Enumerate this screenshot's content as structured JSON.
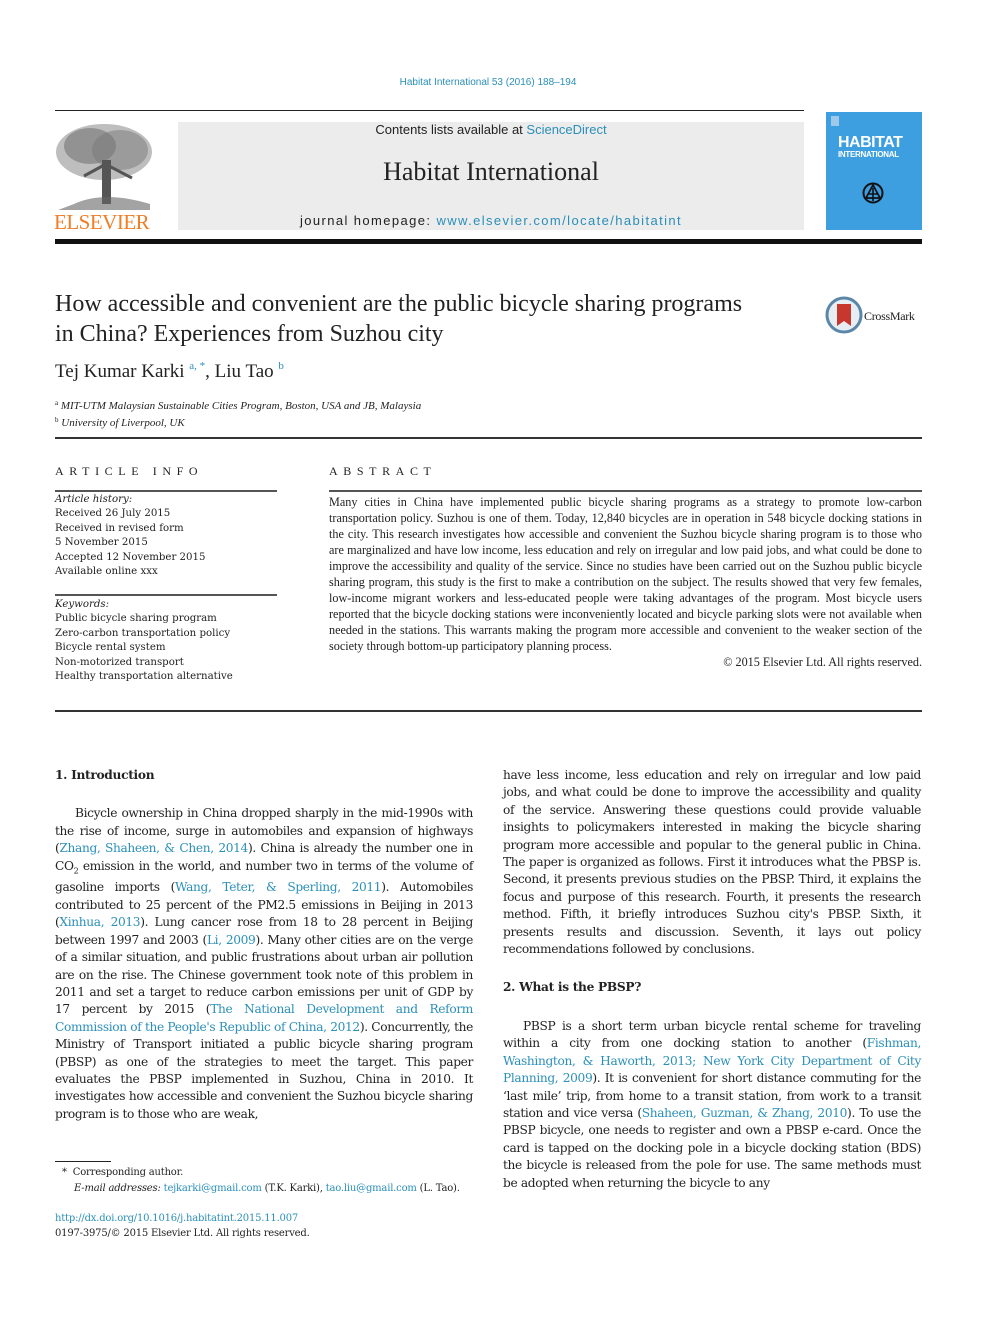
{
  "citation": "Habitat International 53 (2016) 188–194",
  "masthead": {
    "contents_prefix": "Contents lists available at ",
    "contents_link": "ScienceDirect",
    "journal_name": "Habitat International",
    "homepage_prefix": "journal homepage: ",
    "homepage_link": "www.elsevier.com/locate/habitatint"
  },
  "publisher_logo": "ELSEVIER",
  "cover": {
    "title": "HABITAT",
    "subtitle": "INTERNATIONAL"
  },
  "crossmark_label": "CrossMark",
  "article": {
    "title": "How accessible and convenient are the public bicycle sharing programs in China? Experiences from Suzhou city",
    "authors": [
      {
        "name": "Tej Kumar Karki",
        "marks": "a, *"
      },
      {
        "name": "Liu Tao",
        "marks": "b"
      }
    ],
    "affiliations": [
      {
        "mark": "a",
        "text": "MIT-UTM Malaysian Sustainable Cities Program, Boston, USA and JB, Malaysia"
      },
      {
        "mark": "b",
        "text": "University of Liverpool, UK"
      }
    ]
  },
  "article_info": {
    "heading": "ARTICLE INFO",
    "history_label": "Article history:",
    "history": [
      "Received 26 July 2015",
      "Received in revised form",
      "5 November 2015",
      "Accepted 12 November 2015",
      "Available online xxx"
    ],
    "keywords_label": "Keywords:",
    "keywords": [
      "Public bicycle sharing program",
      "Zero-carbon transportation policy",
      "Bicycle rental system",
      "Non-motorized transport",
      "Healthy transportation alternative"
    ]
  },
  "abstract": {
    "heading": "ABSTRACT",
    "text": "Many cities in China have implemented public bicycle sharing programs as a strategy to promote low-carbon transportation policy. Suzhou is one of them. Today, 12,840 bicycles are in operation in 548 bicycle docking stations in the city. This research investigates how accessible and convenient the Suzhou bicycle sharing program is to those who are marginalized and have low income, less education and rely on irregular and low paid jobs, and what could be done to improve the accessibility and quality of the service. Since no studies have been carried out on the Suzhou public bicycle sharing program, this study is the first to make a contribution on the subject. The results showed that very few females, low-income migrant workers and less-educated people were taking advantages of the program. Most bicycle users reported that the bicycle docking stations were inconveniently located and bicycle parking slots were not available when needed in the stations. This warrants making the program more accessible and convenient to the weaker section of the society through bottom-up participatory planning process.",
    "copyright": "© 2015 Elsevier Ltd. All rights reserved."
  },
  "body": {
    "section1": {
      "heading": "1.  Introduction",
      "segments": [
        {
          "t": "Bicycle ownership in China dropped sharply in the mid-1990s with the rise of income, surge in automobiles and expansion of highways ("
        },
        {
          "link": "Zhang, Shaheen, & Chen, 2014"
        },
        {
          "t": "). China is already the number one in CO"
        },
        {
          "sub": "2"
        },
        {
          "t": " emission in the world, and number two in terms of the volume of gasoline imports ("
        },
        {
          "link": "Wang, Teter, & Sperling, 2011"
        },
        {
          "t": "). Automobiles contributed to 25 percent of the PM2.5 emissions in Beijing in 2013 ("
        },
        {
          "link": "Xinhua, 2013"
        },
        {
          "t": "). Lung cancer rose from 18 to 28 percent in Beijing between 1997 and 2003 ("
        },
        {
          "link": "Li, 2009"
        },
        {
          "t": "). Many other cities are on the verge of a similar situation, and public frustrations about urban air pollution are on the rise. The Chinese government took note of this problem in 2011 and set a target to reduce carbon emissions per unit of GDP by 17 percent by 2015 ("
        },
        {
          "link": "The National Development and Reform Commission of the People's Republic of China, 2012"
        },
        {
          "t": "). Concurrently, the Ministry of Transport initiated a public bicycle sharing program (PBSP) as one of the strategies to meet the target. This paper evaluates the PBSP implemented in Suzhou, China in 2010. It investigates how accessible and convenient the Suzhou bicycle sharing program is to those who are weak, "
        }
      ],
      "continuation": "have less income, less education and rely on irregular and low paid jobs, and what could be done to improve the accessibility and quality of the service. Answering these questions could provide valuable insights to policymakers interested in making the bicycle sharing program more accessible and popular to the general public in China. The paper is organized as follows. First it introduces what the PBSP is. Second, it presents previous studies on the PBSP. Third, it explains the focus and purpose of this research. Fourth, it presents the research method. Fifth, it briefly introduces Suzhou city's PBSP. Sixth, it presents results and discussion. Seventh, it lays out policy recommendations followed by conclusions."
    },
    "section2": {
      "heading": "2.  What is the PBSP?",
      "segments": [
        {
          "t": "PBSP is a short term urban bicycle rental scheme for traveling within a city from one docking station to another ("
        },
        {
          "link": "Fishman, Washington, & Haworth, 2013; New York City Department of City Planning, 2009"
        },
        {
          "t": "). It is convenient for short distance commuting for the ‘last mile’ trip, from home to a transit station, from work to a transit station and vice versa ("
        },
        {
          "link": "Shaheen, Guzman, & Zhang, 2010"
        },
        {
          "t": "). To use the PBSP bicycle, one needs to register and own a PBSP e-card. Once the card is tapped on the docking pole in a bicycle docking station (BDS) the bicycle is released from the pole for use. The same methods must be adopted when returning the bicycle to any"
        }
      ]
    }
  },
  "footnote": {
    "mark": "*",
    "corresponding": "Corresponding author.",
    "email_label": "E-mail addresses:",
    "emails": [
      {
        "address": "tejkarki@gmail.com",
        "owner": "(T.K. Karki)"
      },
      {
        "address": "tao.liu@gmail.com",
        "owner": "(L. Tao)."
      }
    ]
  },
  "doi": "http://dx.doi.org/10.1016/j.habitatint.2015.11.007",
  "issn_line": "0197-3975/© 2015 Elsevier Ltd. All rights reserved.",
  "colors": {
    "link": "#2b8fb8",
    "elsevier_orange": "#f07e26",
    "cover_blue": "#3d9ee0",
    "masthead_gray": "#ececec"
  }
}
